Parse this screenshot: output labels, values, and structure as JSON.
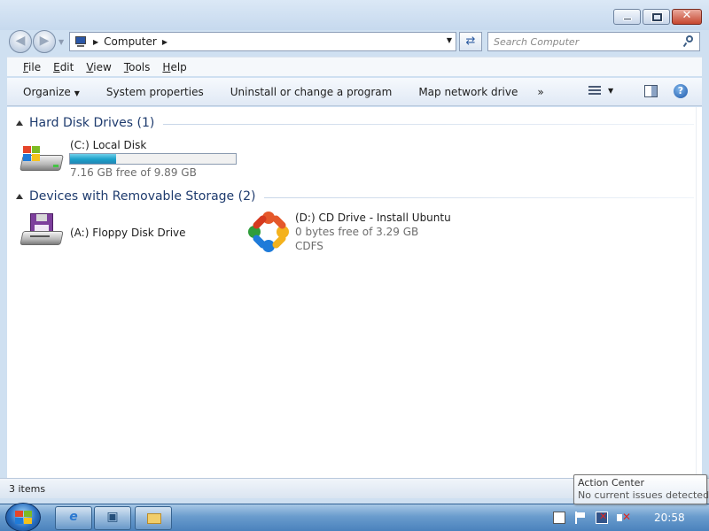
{
  "window": {
    "address": "Computer",
    "search_placeholder": "Search Computer"
  },
  "menu": [
    "File",
    "Edit",
    "View",
    "Tools",
    "Help"
  ],
  "commands": {
    "organize": "Organize",
    "system_properties": "System properties",
    "uninstall": "Uninstall or change a program",
    "map_drive": "Map network drive",
    "more": "»"
  },
  "groups": [
    {
      "title": "Hard Disk Drives (1)",
      "items": [
        {
          "name": "(C:) Local Disk",
          "free_text": "7.16 GB free of 9.89 GB",
          "used_fraction": 0.276,
          "icon": "hard-disk-icon"
        }
      ]
    },
    {
      "title": "Devices with Removable Storage (2)",
      "items": [
        {
          "name": "(A:) Floppy Disk Drive",
          "icon": "floppy-drive-icon"
        },
        {
          "name": "(D:) CD Drive - Install Ubuntu",
          "free_text": "0 bytes free of 3.29 GB",
          "filesystem": "CDFS",
          "icon": "ubuntu-cd-icon"
        }
      ]
    }
  ],
  "status": {
    "text": "3 items"
  },
  "taskbar": {
    "clock": "20:58",
    "buttons": [
      "internet-explorer-icon",
      "server-manager-icon",
      "windows-explorer-icon"
    ]
  },
  "tooltip": {
    "title": "Action Center",
    "body": "No current issues detected"
  },
  "colors": {
    "accent": "#1e3b6e",
    "capacity_fill": "#1ba0c9",
    "close_button": "#c6462f"
  }
}
